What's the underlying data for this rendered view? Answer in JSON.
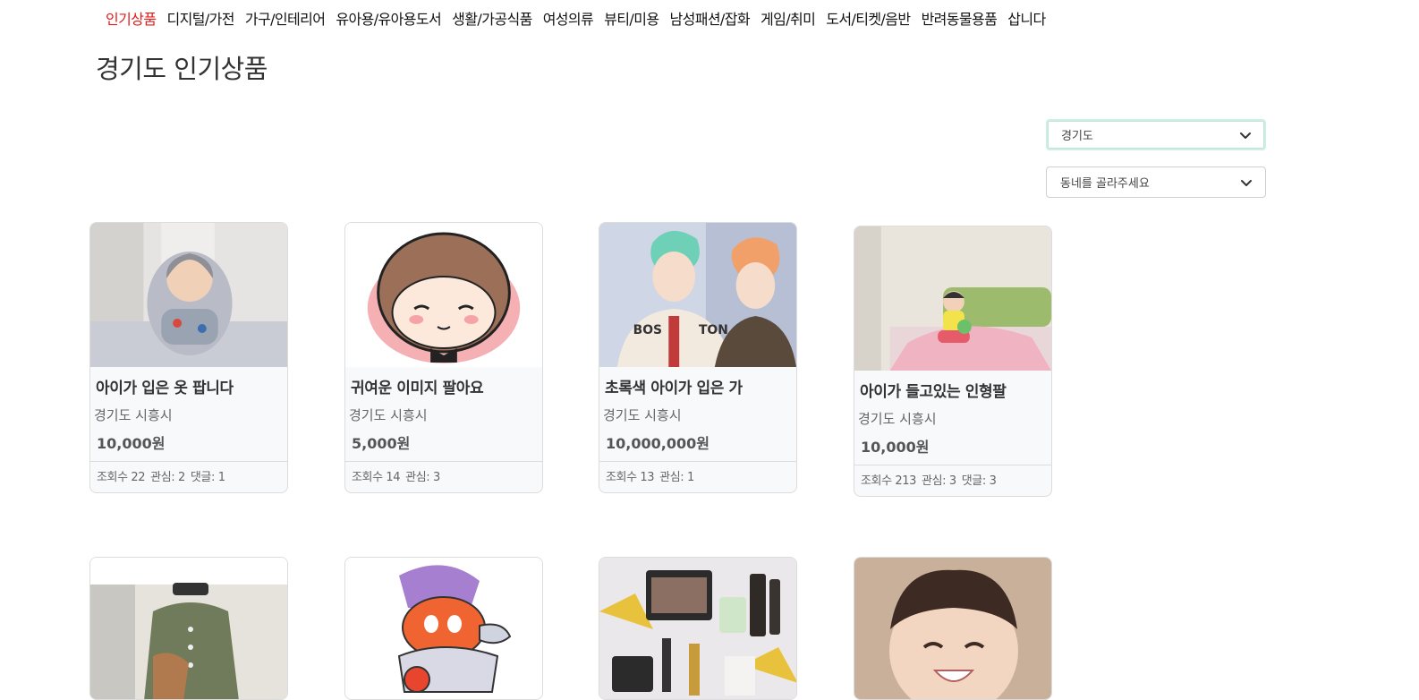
{
  "nav": {
    "items": [
      "인기상품",
      "디지털/가전",
      "가구/인테리어",
      "유아용/유아용도서",
      "생활/가공식품",
      "여성의류",
      "뷰티/미용",
      "남성패션/잡화",
      "게임/취미",
      "도서/티켓/음반",
      "반려동물용품",
      "삽니다"
    ],
    "active_index": 0,
    "active_color": "#e21b1b"
  },
  "page": {
    "title": "경기도 인기상품"
  },
  "filters": {
    "region": {
      "value": "경기도"
    },
    "town": {
      "value": "동네를 골라주세요"
    }
  },
  "products": [
    {
      "title": "아이가 입은 옷 팝니다",
      "location": "경기도 시흥시",
      "price": "10,000원",
      "views": "조회수 22",
      "likes": "관심: 2",
      "comments": "댓글: 1",
      "image_icon": "child-in-hoodie-photo"
    },
    {
      "title": "귀여운 이미지 팔아요",
      "location": "경기도 시흥시",
      "price": "5,000원",
      "views": "조회수 14",
      "likes": "관심: 3",
      "comments": "",
      "image_icon": "cartoon-boy-illustration"
    },
    {
      "title": "초록색 아이가 입은 가",
      "location": "경기도 시흥시",
      "price": "10,000,000원",
      "views": "조회수 13",
      "likes": "관심: 1",
      "comments": "",
      "image_icon": "two-people-photo"
    },
    {
      "title": "아이가 들고있는 인형팔",
      "location": "경기도 시흥시",
      "price": "10,000원",
      "views": "조회수 213",
      "likes": "관심: 3",
      "comments": "댓글: 3",
      "image_icon": "child-on-bed-photo"
    }
  ],
  "products_row2": [
    {
      "image_icon": "cardigan-outfit-photo"
    },
    {
      "image_icon": "game-character-illustration"
    },
    {
      "image_icon": "cosmetics-photo"
    },
    {
      "image_icon": "smiling-child-photo"
    }
  ]
}
